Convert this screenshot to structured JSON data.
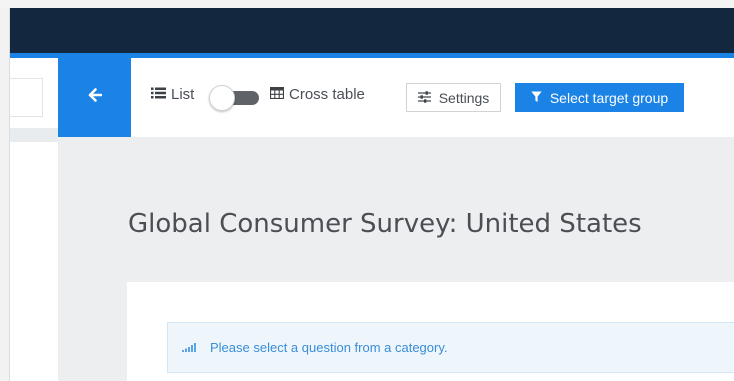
{
  "toolbar": {
    "list_label": "List",
    "cross_table_label": "Cross table",
    "settings_label": "Settings",
    "select_target_group_label": "Select target group"
  },
  "main": {
    "title": "Global Consumer Survey: United States",
    "alert_text": "Please select a question from a category."
  },
  "colors": {
    "topbar": "#13273f",
    "accent": "#1b82e6",
    "toggle_track": "#5f6368",
    "alert_text": "#3a8dd8"
  },
  "icons": {
    "back": "arrow-left-icon",
    "list": "list-icon",
    "cross_table": "table-icon",
    "settings": "sliders-icon",
    "filter": "filter-icon",
    "signal": "signal-bars-icon"
  }
}
